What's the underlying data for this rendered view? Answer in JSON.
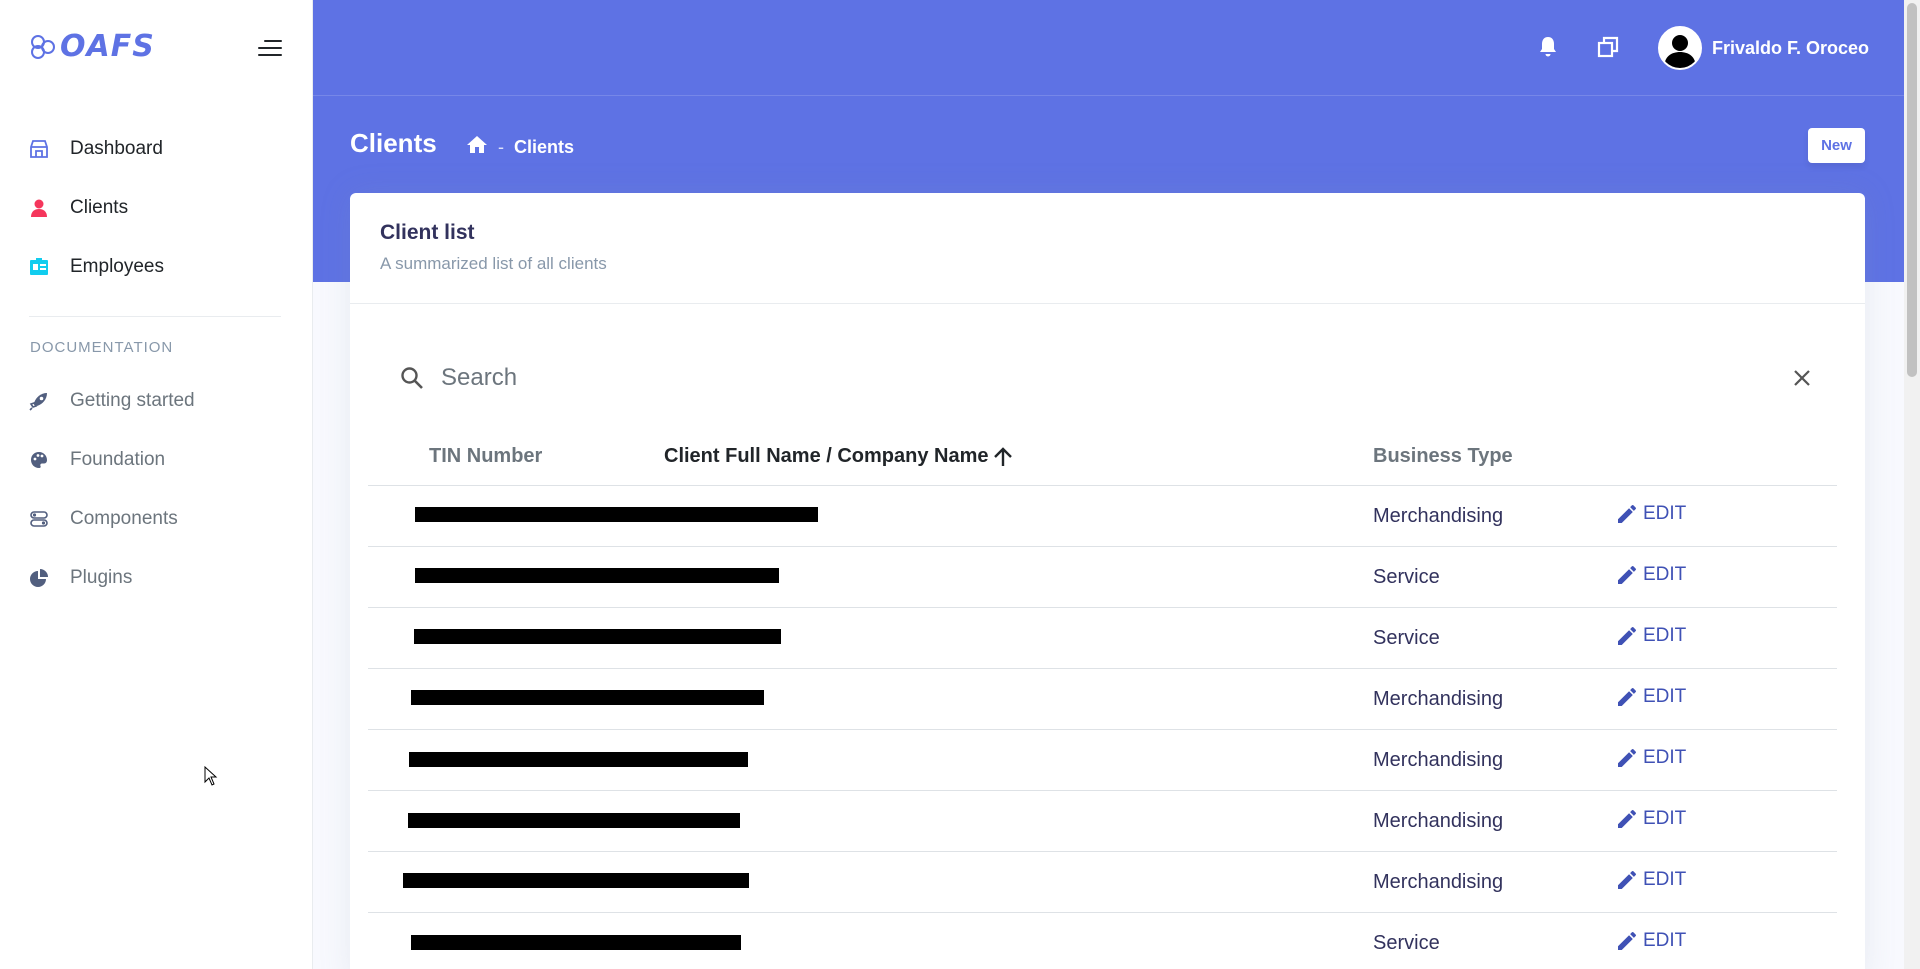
{
  "brand": {
    "name": "OAFS",
    "color": "#5e72e4"
  },
  "sidebar": {
    "main_items": [
      {
        "label": "Dashboard",
        "icon": "shop-icon",
        "color": "#5e72e4"
      },
      {
        "label": "Clients",
        "icon": "user-icon",
        "color": "#f5365c"
      },
      {
        "label": "Employees",
        "icon": "badge-icon",
        "color": "#11cdef"
      }
    ],
    "docs_heading": "DOCUMENTATION",
    "doc_items": [
      {
        "label": "Getting started",
        "icon": "rocket-icon"
      },
      {
        "label": "Foundation",
        "icon": "palette-icon"
      },
      {
        "label": "Components",
        "icon": "ui-components-icon"
      },
      {
        "label": "Plugins",
        "icon": "pie-chart-icon"
      }
    ]
  },
  "header": {
    "user_name": "Frivaldo F. Oroceo",
    "page_title": "Clients",
    "breadcrumb_sep": "-",
    "breadcrumb_current": "Clients",
    "new_button": "New",
    "accent": "#5e72e4"
  },
  "card": {
    "title": "Client list",
    "subtitle": "A summarized list of all clients"
  },
  "search": {
    "placeholder": "Search"
  },
  "table": {
    "columns": {
      "tin": "TIN Number",
      "name": "Client Full Name / Company Name",
      "business_type": "Business Type"
    },
    "edit_label": "EDIT",
    "rows": [
      {
        "business_type": "Merchandising"
      },
      {
        "business_type": "Service"
      },
      {
        "business_type": "Service"
      },
      {
        "business_type": "Merchandising"
      },
      {
        "business_type": "Merchandising"
      },
      {
        "business_type": "Merchandising"
      },
      {
        "business_type": "Merchandising"
      },
      {
        "business_type": "Service"
      }
    ]
  }
}
